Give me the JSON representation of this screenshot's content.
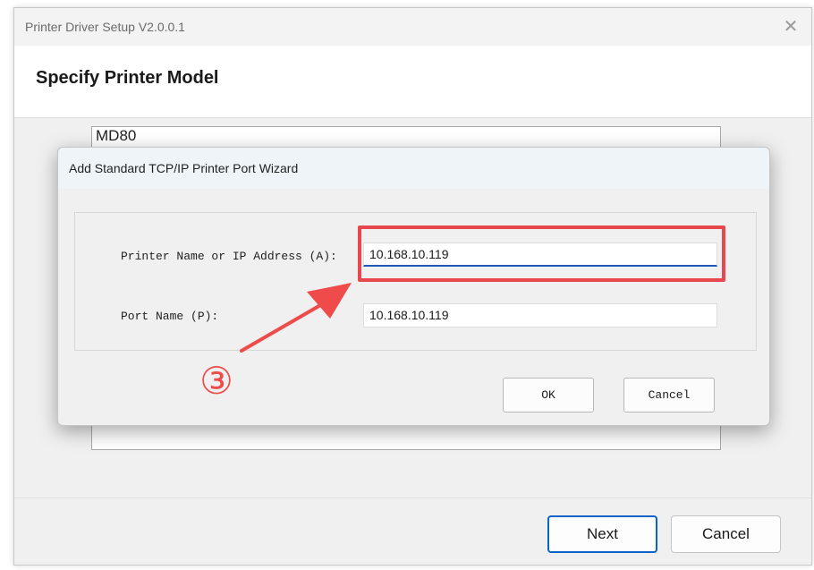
{
  "window": {
    "title": "Printer Driver Setup V2.0.0.1",
    "close_icon": "✕",
    "header_title": "Specify Printer Model",
    "list_items": [
      "MD80"
    ],
    "buttons": {
      "next": "Next",
      "cancel": "Cancel"
    }
  },
  "dialog": {
    "title": "Add Standard TCP/IP Printer Port Wizard",
    "printer_name_label": "Printer Name or IP Address (A):",
    "printer_name_value": "10.168.10.119",
    "port_name_label": "Port Name (P):",
    "port_name_value": "10.168.10.119",
    "buttons": {
      "ok": "OK",
      "cancel": "Cancel"
    }
  },
  "annotation": {
    "step_number": "③",
    "color": "#ef4b4b"
  },
  "colors": {
    "accent": "#0a64c8",
    "focus_underline": "#1f57b6",
    "highlight": "#e8474e"
  }
}
